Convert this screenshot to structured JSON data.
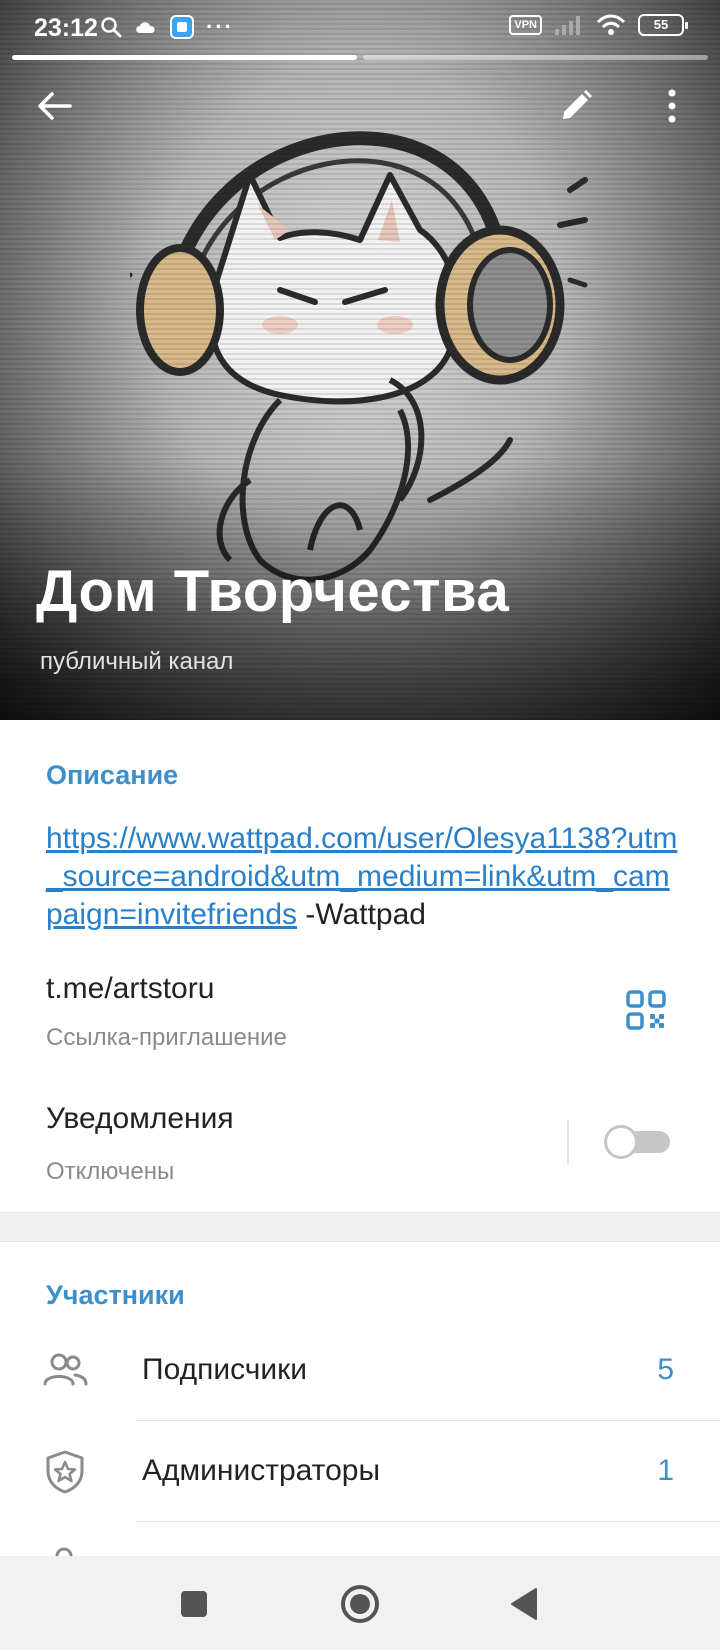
{
  "status_bar": {
    "time": "23:12",
    "vpn": "VPN",
    "battery": "55",
    "overflow": "···"
  },
  "header": {
    "title": "Дом Творчества",
    "subtitle": "публичный канал"
  },
  "info": {
    "description_header": "Описание",
    "description_link": "https://www.wattpad.com/user/Olesya1138?utm_source=android&utm_medium=link&utm_campaign=invitefriends",
    "description_suffix": " -Wattpad",
    "invite_link": "t.me/artstoru",
    "invite_link_label": "Ссылка-приглашение",
    "notifications_title": "Уведомления",
    "notifications_status": "Отключены",
    "notifications_enabled": false
  },
  "members": {
    "header": "Участники",
    "items": [
      {
        "label": "Подписчики",
        "count": "5",
        "icon": "people-icon"
      },
      {
        "label": "Администраторы",
        "count": "1",
        "icon": "shield-star-icon"
      }
    ]
  },
  "colors": {
    "accent": "#3d8fcb",
    "link": "#2a7fc9",
    "toggle_off": "#c6c6c6"
  }
}
